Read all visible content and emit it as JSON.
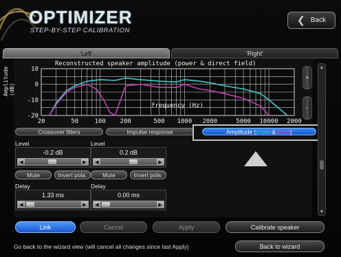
{
  "header": {
    "title": "OPTIMIZER",
    "subtitle": "STEP-BY-STEP CALIBRATION",
    "back_label": "Back"
  },
  "tabs": [
    {
      "label": "'Left'",
      "active": true
    },
    {
      "label": "'Right'",
      "active": false
    }
  ],
  "chart_data": {
    "type": "line",
    "title": "Reconstructed speaker amplitude (power & direct field)",
    "xlabel": "frequency (Hz)",
    "ylabel": "Amplitude (dB)",
    "x_scale": "log",
    "xlim": [
      20,
      20000
    ],
    "ylim": [
      -20,
      10
    ],
    "x_ticks": [
      "20",
      "50",
      "100",
      "200",
      "500",
      "1000",
      "2000",
      "5000",
      "10000",
      "2000"
    ],
    "y_ticks": [
      "10",
      "0",
      "-10",
      "-20"
    ],
    "grid": true,
    "series": [
      {
        "color": "#40c8c8",
        "x": [
          25,
          30,
          40,
          50,
          70,
          100,
          150,
          200,
          300,
          500,
          800,
          1000,
          1500,
          2000,
          3000,
          5000,
          8000,
          10000,
          15000,
          20000
        ],
        "y": [
          -20,
          -12,
          -4,
          -1,
          2,
          3,
          2.5,
          4,
          3,
          2,
          1.5,
          3,
          2,
          1,
          -1,
          -3,
          -6,
          -10,
          -18,
          -24
        ]
      },
      {
        "color": "#c23fb4",
        "x": [
          25,
          30,
          40,
          50,
          70,
          90,
          110,
          130,
          150,
          200,
          300,
          500,
          800,
          1000,
          1500,
          2000,
          3000,
          5000,
          8000,
          10000
        ],
        "y": [
          -20,
          -13,
          -5,
          -2,
          0,
          -3,
          -10,
          -18,
          -20,
          -1,
          0,
          -2,
          -2,
          0,
          -3,
          -4,
          -6,
          -9,
          -14,
          -20
        ]
      }
    ]
  },
  "side_buttons": {
    "plus": "+",
    "minus": "-"
  },
  "subtabs": {
    "crossover": "Crossover filters",
    "impulse": "Impulse response",
    "amplitude_a": "Amplitude (",
    "amplitude_power": "power",
    "amplitude_amp": " & ",
    "amplitude_direct": "direct",
    "amplitude_b": ")"
  },
  "channels": [
    {
      "level_label": "Level",
      "level_value": "-0.2 dB",
      "mute": "Mute",
      "invert": "Invert pola.",
      "delay_label": "Delay",
      "delay_value": "1.33 ms"
    },
    {
      "level_label": "Level",
      "level_value": "0.2 dB",
      "mute": "Mute",
      "invert": "Invert pola.",
      "delay_label": "Delay",
      "delay_value": "0.00 ms"
    }
  ],
  "bottom": {
    "link": "Link",
    "cancel": "Cancel",
    "apply": "Apply",
    "calibrate": "Calibrate speaker",
    "hint": "Go back to the wizard view (will cancel all changes since last Apply)",
    "back_to_wizard": "Back to wizard"
  }
}
